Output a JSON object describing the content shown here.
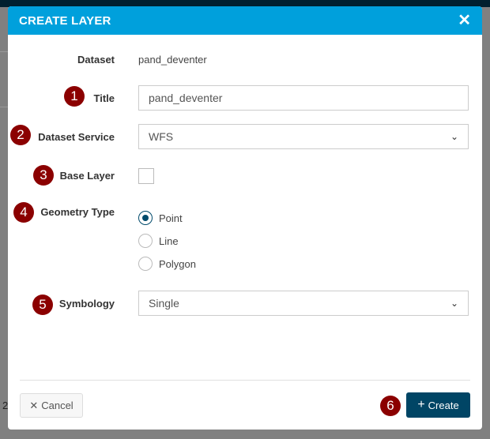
{
  "dialog": {
    "title": "CREATE LAYER",
    "close_icon": "close-icon",
    "fields": {
      "dataset_label": "Dataset",
      "dataset_value": "pand_deventer",
      "title_label": "Title",
      "title_value": "pand_deventer",
      "service_label": "Dataset Service",
      "service_value": "WFS",
      "base_layer_label": "Base Layer",
      "base_layer_checked": false,
      "geometry_label": "Geometry Type",
      "geometry_options": [
        "Point",
        "Line",
        "Polygon"
      ],
      "geometry_selected": "Point",
      "symbology_label": "Symbology",
      "symbology_value": "Single"
    },
    "cancel_label": "Cancel",
    "create_label": "Create"
  },
  "badges": [
    "1",
    "2",
    "3",
    "4",
    "5",
    "6"
  ],
  "background": {
    "partial_text": "2"
  },
  "colors": {
    "header": "#00a0dc",
    "primary_button": "#004565",
    "badge": "#8b0000"
  }
}
